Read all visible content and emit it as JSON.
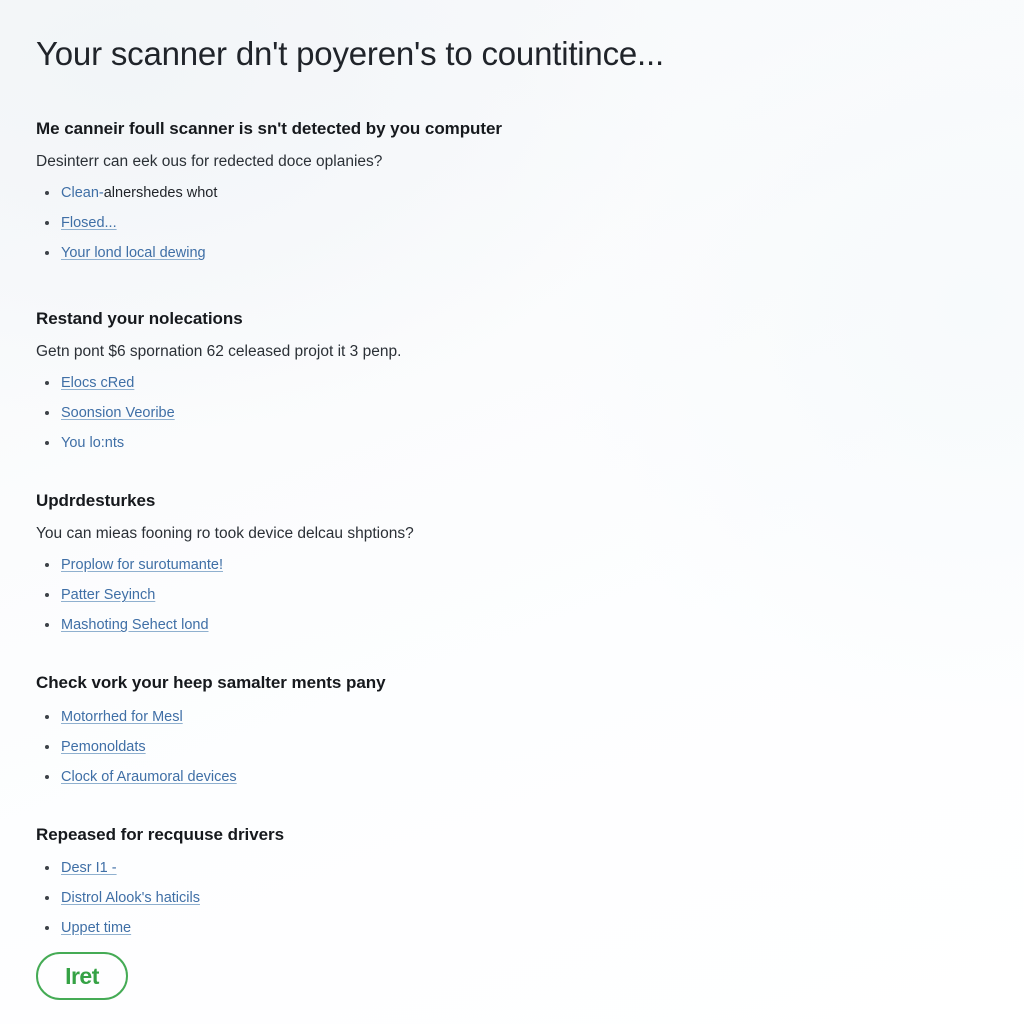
{
  "page": {
    "title": "Your scanner dn't poyeren's to countitince..."
  },
  "sections": [
    {
      "heading": "Me canneir foull scanner is sn't detected by you computer",
      "subtitle": "Desinterr can eek ous for redected doce oplanies?",
      "items": [
        {
          "label": "Clean-",
          "tail": "alnershedes whot",
          "underline": false
        },
        {
          "label": "Flosed...",
          "tail": "",
          "underline": true
        },
        {
          "label": "Your lond local dewing",
          "tail": "",
          "underline": true
        }
      ]
    },
    {
      "heading": "Restand your nolecations",
      "subtitle": "Getn pont $6 spornation 62 celeased projot it 3 penp.",
      "items": [
        {
          "label": "Elocs cRed",
          "tail": "",
          "underline": true
        },
        {
          "label": "Soonsion Veoribe",
          "tail": "",
          "underline": true
        },
        {
          "label": "You lo:nts",
          "tail": "",
          "underline": false
        }
      ]
    },
    {
      "heading": "Updrdesturkes",
      "subtitle": "You can mieas fooning ro took device delcau shptions?",
      "items": [
        {
          "label": "Proplow for surotumante!",
          "tail": "",
          "underline": true
        },
        {
          "label": "Patter Seyinch",
          "tail": "",
          "underline": true
        },
        {
          "label": "Mashoting Sehect lond",
          "tail": "",
          "underline": true
        }
      ]
    },
    {
      "heading": "Check vork your heep samalter ments pany",
      "subtitle": "",
      "items": [
        {
          "label": "Motorrhed for Mesl",
          "tail": "",
          "underline": true
        },
        {
          "label": "Pemonoldats",
          "tail": "",
          "underline": true
        },
        {
          "label": "Clock of Araumoral devices",
          "tail": "",
          "underline": true
        }
      ]
    },
    {
      "heading": "Repeased for recquuse drivers",
      "subtitle": "",
      "items": [
        {
          "label": "Desr I1 -",
          "tail": "",
          "underline": true
        },
        {
          "label": "Distrol Alook's haticils",
          "tail": "",
          "underline": true
        },
        {
          "label": "Uppet time",
          "tail": "",
          "underline": true
        }
      ]
    }
  ],
  "badge": {
    "text": "Iret",
    "dot": "·",
    "color": "#35a245",
    "border_color": "#45ab55"
  },
  "colors": {
    "link": "#3f6fa6",
    "heading": "#16191d",
    "body": "#2b3036",
    "accent_green": "#35a245"
  }
}
